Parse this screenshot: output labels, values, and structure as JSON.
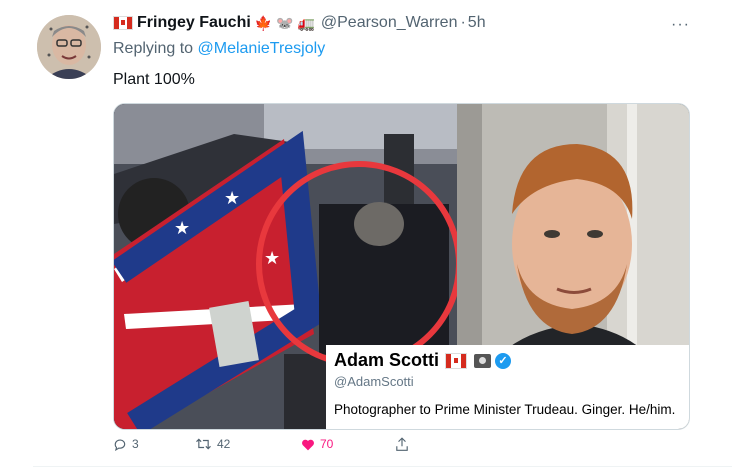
{
  "tweet": {
    "display_name": "Fringey Fauchi",
    "name_emojis": "🍁 🐭 🚛",
    "handle": "@Pearson_Warren",
    "time": "5h",
    "more": "···",
    "replying_prefix": "Replying to",
    "replying_to": "@MelanieTresjoly",
    "text": "Plant 100%"
  },
  "card": {
    "name": "Adam Scotti",
    "handle": "@AdamScotti",
    "bio": "Photographer to Prime Minister Trudeau. Ginger. He/him."
  },
  "actions": {
    "replies": "3",
    "retweets": "42",
    "likes": "70"
  },
  "colors": {
    "accent": "#1d9bf0",
    "like": "#f91880",
    "muted": "#536471",
    "circle": "#e8383d"
  }
}
